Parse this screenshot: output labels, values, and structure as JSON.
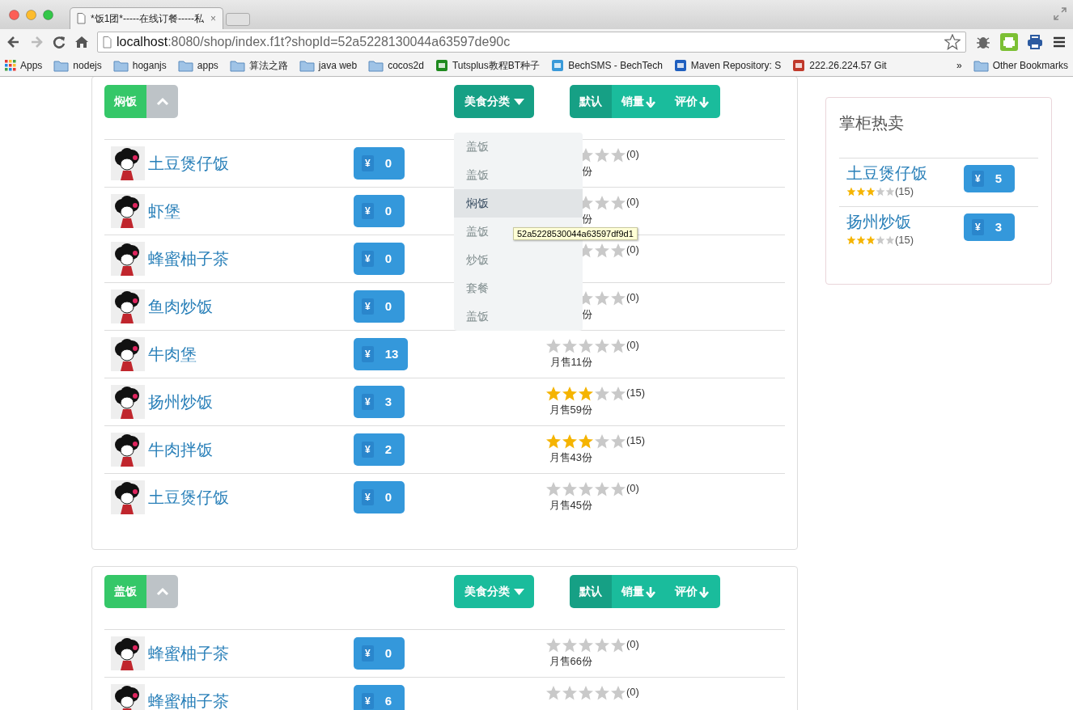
{
  "browser": {
    "tab_title": "*饭1团*-----在线订餐-----私",
    "tab_close": "×",
    "url_host": "localhost",
    "url_rest": ":8080/shop/index.f1t?shopId=52a5228130044a63597de90c",
    "bookmarks": [
      {
        "label": "Apps",
        "kind": "apps"
      },
      {
        "label": "nodejs",
        "kind": "folder"
      },
      {
        "label": "hoganjs",
        "kind": "folder"
      },
      {
        "label": "apps",
        "kind": "folder"
      },
      {
        "label": "算法之路",
        "kind": "folder"
      },
      {
        "label": "java web",
        "kind": "folder"
      },
      {
        "label": "cocos2d",
        "kind": "folder"
      },
      {
        "label": "Tutsplus教程BT种子",
        "kind": "site",
        "color": "#1e8a1e"
      },
      {
        "label": "BechSMS - BechTech",
        "kind": "site",
        "color": "#3a9ad9"
      },
      {
        "label": "Maven Repository: S",
        "kind": "site",
        "color": "#1f5fbf"
      },
      {
        "label": "222.26.224.57 Git",
        "kind": "site",
        "color": "#c0392b"
      }
    ],
    "overflow": "»",
    "other_bookmarks": "Other Bookmarks"
  },
  "sections": [
    {
      "category": "焖饭",
      "filter": {
        "label": "美食分类",
        "open": true,
        "options": [
          {
            "label": "盖饭",
            "selected": false
          },
          {
            "label": "盖饭",
            "selected": false
          },
          {
            "label": "焖饭",
            "selected": true
          },
          {
            "label": "盖饭",
            "selected": false
          },
          {
            "label": "炒饭",
            "selected": false
          },
          {
            "label": "套餐",
            "selected": false
          },
          {
            "label": "盖饭",
            "selected": false
          }
        ],
        "tooltip": "52a5228530044a63597df9d1"
      },
      "sort": [
        {
          "label": "默认",
          "selected": true,
          "descending": false
        },
        {
          "label": "销量",
          "selected": false,
          "descending": true
        },
        {
          "label": "评价",
          "selected": false,
          "descending": true
        }
      ],
      "dishes": [
        {
          "name": "土豆煲仔饭",
          "currency": "¥",
          "price": "0",
          "stars": 0,
          "votes": "(0)",
          "sales": "份"
        },
        {
          "name": "虾堡",
          "currency": "¥",
          "price": "0",
          "stars": 0,
          "votes": "(0)",
          "sales": "份"
        },
        {
          "name": "蜂蜜柚子茶",
          "currency": "¥",
          "price": "0",
          "stars": 0,
          "votes": "(0)"
        },
        {
          "name": "鱼肉炒饭",
          "currency": "¥",
          "price": "0",
          "stars": 0,
          "votes": "(0)",
          "sales": "份"
        },
        {
          "name": "牛肉堡",
          "currency": "¥",
          "price": "13",
          "stars": 0,
          "votes": "(0)",
          "sales": "月售11份"
        },
        {
          "name": "扬州炒饭",
          "currency": "¥",
          "price": "3",
          "stars": 3,
          "votes": "(15)",
          "sales": "月售59份"
        },
        {
          "name": "牛肉拌饭",
          "currency": "¥",
          "price": "2",
          "stars": 3,
          "votes": "(15)",
          "sales": "月售43份"
        },
        {
          "name": "土豆煲仔饭",
          "currency": "¥",
          "price": "0",
          "stars": 0,
          "votes": "(0)",
          "sales": "月售45份"
        }
      ]
    },
    {
      "category": "盖饭",
      "filter": {
        "label": "美食分类",
        "open": false
      },
      "sort": [
        {
          "label": "默认",
          "selected": true,
          "descending": false
        },
        {
          "label": "销量",
          "selected": false,
          "descending": true
        },
        {
          "label": "评价",
          "selected": false,
          "descending": true
        }
      ],
      "dishes": [
        {
          "name": "蜂蜜柚子茶",
          "currency": "¥",
          "price": "0",
          "stars": 0,
          "votes": "(0)",
          "sales": "月售66份"
        },
        {
          "name": "蜂蜜柚子茶",
          "currency": "¥",
          "price": "6",
          "stars": 0,
          "votes": "(0)"
        }
      ]
    }
  ],
  "sidebar": {
    "title": "掌柜热卖",
    "items": [
      {
        "name": "土豆煲仔饭",
        "stars": 3,
        "votes": "(15)",
        "currency": "¥",
        "price": "5"
      },
      {
        "name": "扬州炒饭",
        "stars": 3,
        "votes": "(15)",
        "currency": "¥",
        "price": "3"
      }
    ]
  }
}
